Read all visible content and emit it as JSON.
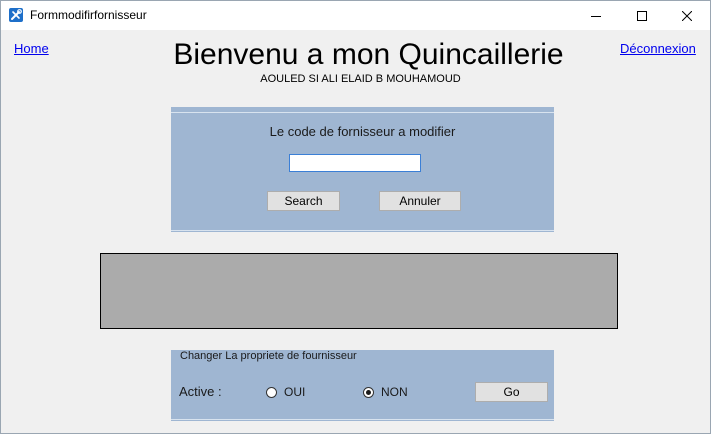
{
  "window": {
    "title": "Formmodifirfornisseur",
    "controls": [
      "minimize-icon",
      "maximize-icon",
      "close-icon"
    ]
  },
  "nav": {
    "home": "Home",
    "logout": "Déconnexion"
  },
  "header": {
    "title": "Bienvenu a mon Quincaillerie",
    "subtitle": "AOULED SI ALI ELAID B MOUHAMOUD"
  },
  "search_panel": {
    "label": "Le code de fornisseur a modifier",
    "input_value": "",
    "search_button": "Search",
    "cancel_button": "Annuler"
  },
  "property_panel": {
    "title": "Changer La propriete de fournisseur",
    "active_label": "Active :",
    "option_yes": "OUI",
    "option_no": "NON",
    "selected": "NON",
    "go_button": "Go"
  },
  "colors": {
    "panel": "#9fb6d2",
    "grid": "#ababab",
    "link": "#0000ee",
    "background": "#f0f0f0"
  }
}
